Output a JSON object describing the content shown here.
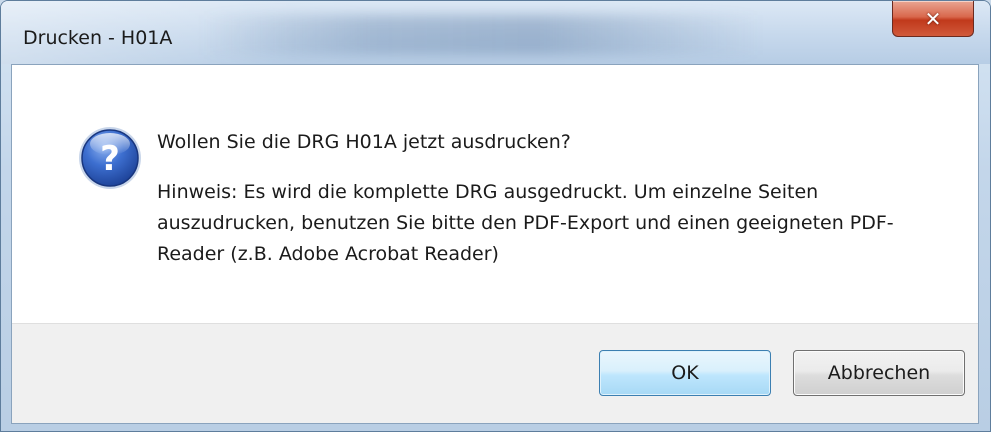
{
  "window": {
    "title": "Drucken - H01A"
  },
  "title_bar": {
    "close_icon": "close-icon",
    "close_glyph": "✕"
  },
  "dialog": {
    "icon": "question-icon",
    "main_instruction": "Wollen Sie die DRG H01A jetzt ausdrucken?",
    "hint": "Hinweis: Es wird die komplette DRG ausgedruckt. Um einzelne Seiten auszudrucken, benutzen Sie bitte den PDF-Export und einen geeigneten PDF-Reader (z.B. Adobe Acrobat Reader)"
  },
  "buttons": {
    "ok_label": "OK",
    "cancel_label": "Abbrechen"
  },
  "colors": {
    "accent_blue": "#3c7fb1",
    "close_red": "#c1391c",
    "icon_blue": "#2a57b6"
  }
}
